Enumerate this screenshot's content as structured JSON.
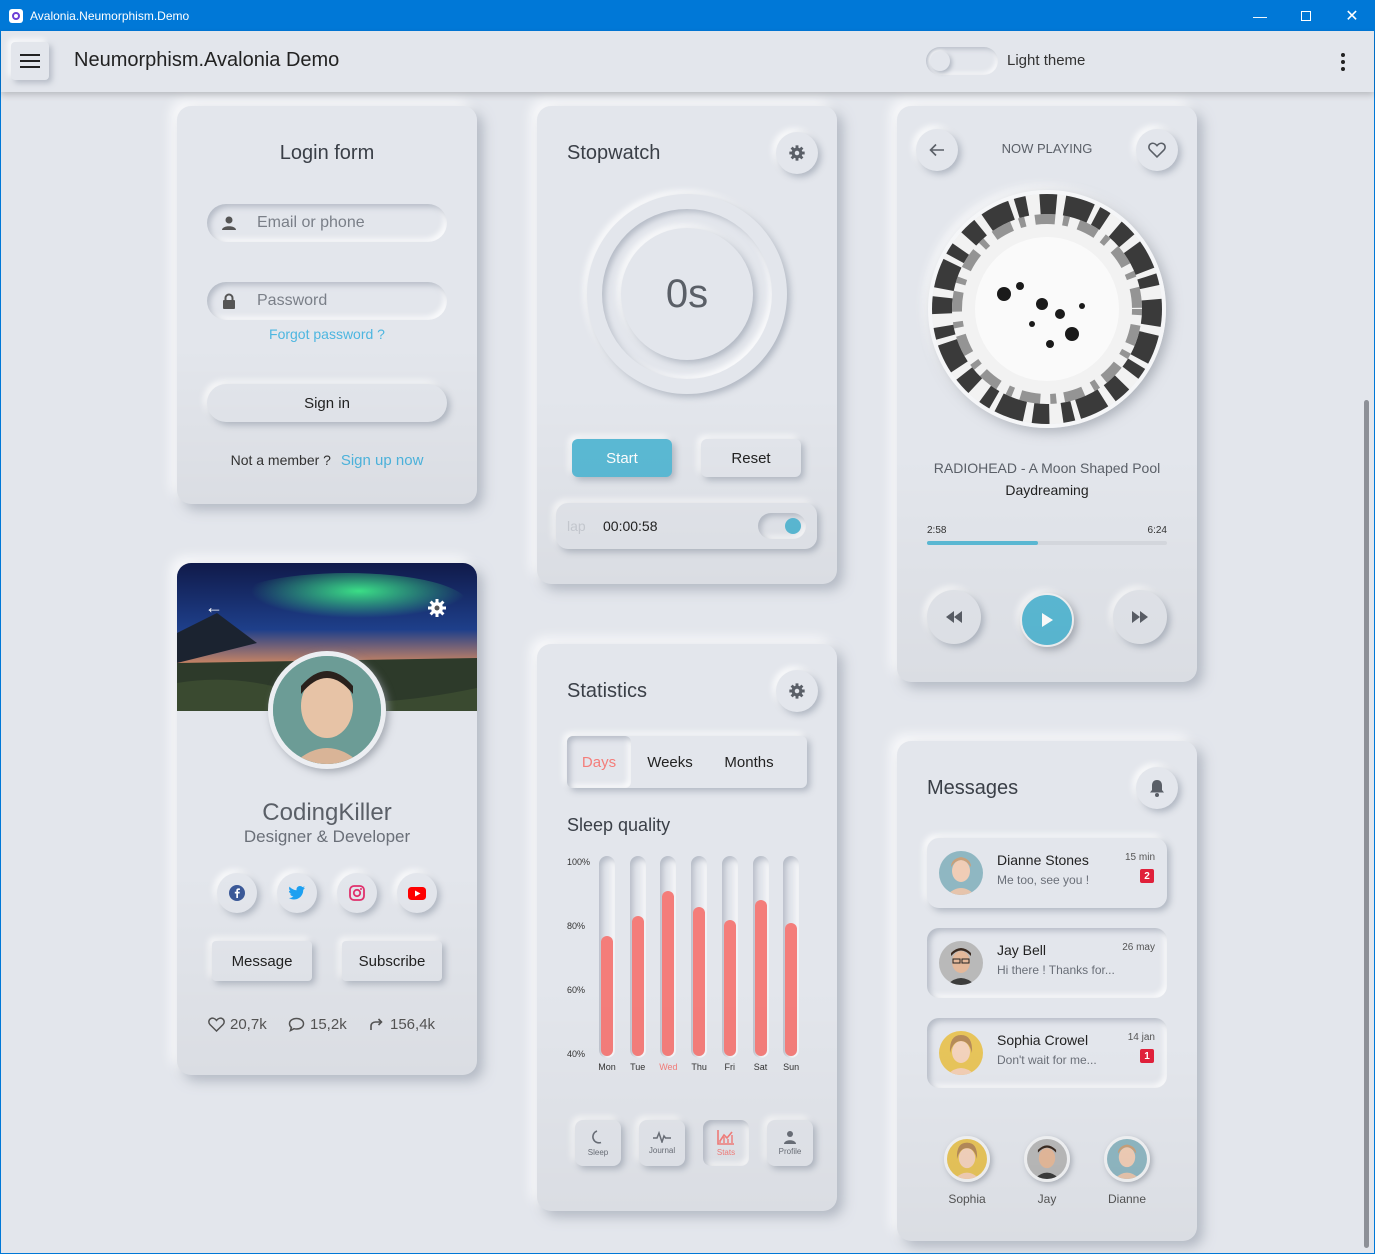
{
  "window": {
    "title": "Avalonia.Neumorphism.Demo"
  },
  "appbar": {
    "title": "Neumorphism.Avalonia Demo",
    "theme_label": "Light theme",
    "theme_on": false
  },
  "login": {
    "title": "Login form",
    "email_placeholder": "Email or phone",
    "password_placeholder": "Password",
    "forgot": "Forgot password ?",
    "sign_in": "Sign in",
    "not_member": "Not a member ?",
    "sign_up": "Sign up now"
  },
  "stopwatch": {
    "title": "Stopwatch",
    "display": "0s",
    "start": "Start",
    "reset": "Reset",
    "lap_label": "lap",
    "lap_time": "00:00:58",
    "lap_toggle_on": true
  },
  "player": {
    "header": "NOW PLAYING",
    "album": "RADIOHEAD - A Moon Shaped Pool",
    "track": "Daydreaming",
    "elapsed": "2:58",
    "duration": "6:24",
    "progress_fraction": 0.4635
  },
  "profile": {
    "name": "CodingKiller",
    "role": "Designer & Developer",
    "message": "Message",
    "subscribe": "Subscribe",
    "likes": "20,7k",
    "comments": "15,2k",
    "shares": "156,4k",
    "socials": [
      "facebook-icon",
      "twitter-icon",
      "instagram-icon",
      "youtube-icon"
    ]
  },
  "statistics": {
    "title": "Statistics",
    "tabs": [
      "Days",
      "Weeks",
      "Months"
    ],
    "selected_tab": "Days",
    "chart_title": "Sleep quality",
    "nav": [
      "Sleep",
      "Journal",
      "Stats",
      "Profile"
    ],
    "selected_nav": "Stats"
  },
  "chart_data": {
    "type": "bar",
    "title": "Sleep quality",
    "categories": [
      "Mon",
      "Tue",
      "Wed",
      "Thu",
      "Fri",
      "Sat",
      "Sun"
    ],
    "values": [
      77,
      83,
      91,
      86,
      82,
      88,
      81
    ],
    "y_ticks": [
      "100%",
      "80%",
      "60%",
      "40%"
    ],
    "ylim": [
      40,
      100
    ],
    "highlight": "Wed",
    "bar_color": "#f47d7a"
  },
  "messages": {
    "title": "Messages",
    "items": [
      {
        "name": "Dianne Stones",
        "text": "Me too, see you !",
        "time": "15 min",
        "badge": "2"
      },
      {
        "name": "Jay Bell",
        "text": "Hi there ! Thanks for...",
        "time": "26 may",
        "badge": ""
      },
      {
        "name": "Sophia Crowel",
        "text": "Don't wait for me...",
        "time": "14 jan",
        "badge": "1"
      }
    ],
    "contacts": [
      "Sophia",
      "Jay",
      "Dianne"
    ]
  },
  "colors": {
    "accent": "#5bbad5",
    "link": "#4db6e0",
    "bar": "#f47d7a",
    "badge": "#e0203a",
    "titlebar": "#0078d7"
  }
}
